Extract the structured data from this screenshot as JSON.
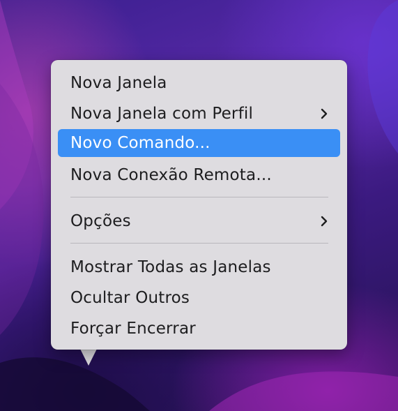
{
  "menu": {
    "items": [
      {
        "label": "Nova Janela",
        "submenu": false,
        "highlighted": false
      },
      {
        "label": "Nova Janela com Perfil",
        "submenu": true,
        "highlighted": false
      },
      {
        "label": "Novo Comando...",
        "submenu": false,
        "highlighted": true
      },
      {
        "label": "Nova Conexão Remota...",
        "submenu": false,
        "highlighted": false
      },
      {
        "label": "Opções",
        "submenu": true,
        "highlighted": false
      },
      {
        "label": "Mostrar Todas as Janelas",
        "submenu": false,
        "highlighted": false
      },
      {
        "label": "Ocultar Outros",
        "submenu": false,
        "highlighted": false
      },
      {
        "label": "Forçar Encerrar",
        "submenu": false,
        "highlighted": false
      }
    ],
    "submenu_icon": "chevron-right-icon"
  },
  "colors": {
    "menu_background": "#dedce0",
    "highlight": "#3a8ff5",
    "text": "#1d1d1f",
    "separator": "#b9b7bc"
  }
}
